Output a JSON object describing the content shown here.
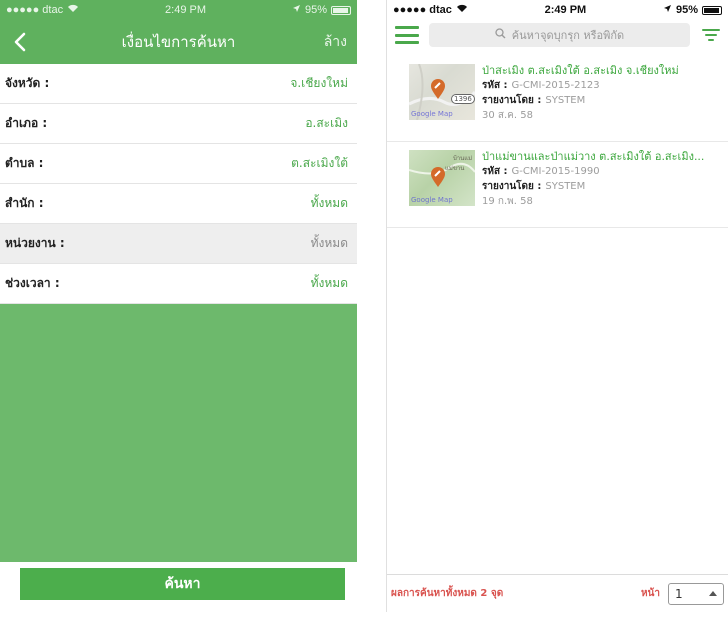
{
  "left": {
    "status": {
      "carrier": "●●●●● dtac",
      "time": "2:49 PM",
      "battery": "95%"
    },
    "nav": {
      "back_icon": "chevron-left-icon",
      "title": "เงื่อนไขการค้นหา",
      "action": "ล้าง"
    },
    "filters": [
      {
        "label": "จังหวัด :",
        "value": "จ.เชียงใหม่"
      },
      {
        "label": "อำเภอ :",
        "value": "อ.สะเมิง"
      },
      {
        "label": "ตำบล :",
        "value": "ต.สะเมิงใต้"
      },
      {
        "label": "สำนัก :",
        "value": "ทั้งหมด"
      },
      {
        "label": "หน่วยงาน :",
        "value": "ทั้งหมด"
      },
      {
        "label": "ช่วงเวลา :",
        "value": "ทั้งหมด"
      }
    ],
    "search_button": "ค้นหา"
  },
  "right": {
    "status": {
      "carrier": "●●●●● dtac",
      "time": "2:49 PM",
      "battery": "95%"
    },
    "search": {
      "placeholder": "ค้นหาจุดบุกรุก หรือพิกัด",
      "menu_icon": "hamburger-menu-icon",
      "search_icon": "magnifier-icon",
      "filter_icon": "filter-icon"
    },
    "results": [
      {
        "title": "ป่าสะเมิง ต.สะเมิงใต้ อ.สะเมิง จ.เชียงใหม่",
        "code_label": "รหัส :",
        "code": "G-CMI-2015-2123",
        "reporter_label": "รายงานโดย :",
        "reporter": "SYSTEM",
        "date": "30 ส.ค. 58",
        "map_badge": "1396",
        "map_watermark": "Google Map"
      },
      {
        "title": "ป่าแม่ขานและป่าแม่วาง ต.สะเมิงใต้ อ.สะเมิง...",
        "code_label": "รหัส :",
        "code": "G-CMI-2015-1990",
        "reporter_label": "รายงานโดย :",
        "reporter": "SYSTEM",
        "date": "19 ก.พ. 58",
        "map_label_1": "บ้านแม่",
        "map_label_2": "แม่ขาน",
        "map_watermark": "Google Map"
      }
    ],
    "footer": {
      "count": "ผลการค้นหาทั้งหมด 2 จุด",
      "page_label": "หน้า",
      "page_value": "1"
    }
  },
  "colors": {
    "primary_green": "#5fb15e",
    "button_green": "#4cae4c",
    "accent_red": "#d9534f",
    "value_green": "#4aa84b"
  }
}
